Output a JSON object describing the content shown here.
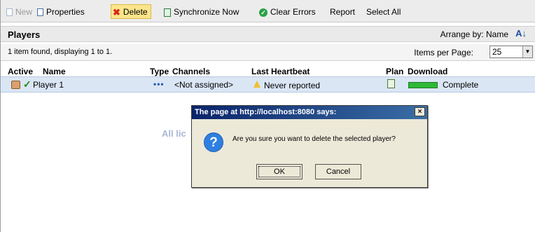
{
  "toolbar": {
    "new_label": "New",
    "properties_label": "Properties",
    "delete_label": "Delete",
    "sync_label": "Synchronize Now",
    "clear_label": "Clear Errors",
    "report_label": "Report",
    "select_all_label": "Select All"
  },
  "header": {
    "title": "Players",
    "arrange_label": "Arrange by: Name"
  },
  "info": {
    "found_text": "1 item found, displaying 1 to 1.",
    "items_per_page_label": "Items per Page:",
    "items_per_page_value": "25"
  },
  "table": {
    "columns": [
      "Active",
      "Name",
      "Type",
      "Channels",
      "Last Heartbeat",
      "Plan",
      "Download"
    ],
    "rows": [
      {
        "active": "✓",
        "name": "Player 1",
        "type": "•••",
        "channels": "<Not assigned>",
        "last_heartbeat": "Never reported",
        "download": "Complete",
        "download_progress": 1.0
      }
    ]
  },
  "background_text": "All lic",
  "dialog": {
    "title": "The page at http://localhost:8080 says:",
    "message": "Are you sure you want to delete the selected player?",
    "ok_label": "OK",
    "cancel_label": "Cancel",
    "close_glyph": "×",
    "icon_glyph": "?"
  }
}
